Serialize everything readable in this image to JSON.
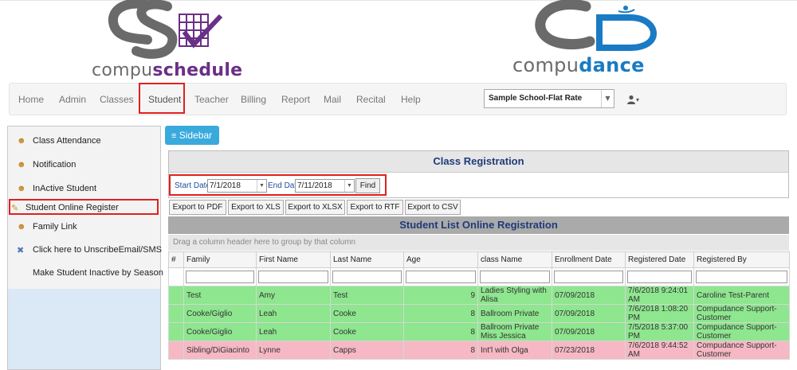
{
  "logos": {
    "left": {
      "prefix": "compu",
      "bold": "schedule"
    },
    "right": {
      "prefix": "compu",
      "bold": "dance"
    }
  },
  "nav": {
    "items": [
      "Home",
      "Admin",
      "Classes",
      "Student",
      "Teacher",
      "Billing",
      "Report",
      "Mail",
      "Recital",
      "Help"
    ],
    "active": "Student",
    "school_select": "Sample School-Flat Rate",
    "user_icon": "user-icon"
  },
  "sidebar": {
    "toggle_label": "Sidebar",
    "items": [
      {
        "label": "Class Attendance",
        "icon": "users-icon"
      },
      {
        "label": "Notification",
        "icon": "users-icon"
      },
      {
        "label": "InActive Student",
        "icon": "users-icon"
      },
      {
        "label": "Student Online Register",
        "icon": "pencil-icon"
      },
      {
        "label": "Family Link",
        "icon": "users-icon"
      },
      {
        "label": "Click here to UnscribeEmail/SMS",
        "icon": "wrench-icon"
      },
      {
        "label": "Make Student Inactive by Season",
        "icon": ""
      }
    ]
  },
  "registration": {
    "title": "Class Registration",
    "start_label": "Start Date",
    "start_value": "7/1/2018",
    "end_label": "End Date",
    "end_value": "7/11/2018",
    "find_label": "Find"
  },
  "exports": [
    "Export to PDF",
    "Export to XLS",
    "Export to XLSX",
    "Export to RTF",
    "Export to CSV"
  ],
  "student_list": {
    "title": "Student List Online Registration",
    "group_hint": "Drag a column header here to group by that column",
    "columns": [
      "#",
      "Family",
      "First Name",
      "Last Name",
      "Age",
      "class Name",
      "Enrollment Date",
      "Registered Date",
      "Registered By"
    ],
    "rows": [
      {
        "family": "Test",
        "first": "Amy",
        "last": "Test",
        "age": "9",
        "class": "Ladies Styling with Alisa",
        "enroll": "07/09/2018",
        "registered": "7/6/2018 9:24:01 AM",
        "by": "Caroline Test-Parent",
        "status": "green"
      },
      {
        "family": "Cooke/Giglio",
        "first": "Leah",
        "last": "Cooke",
        "age": "8",
        "class": "Ballroom Private",
        "enroll": "07/09/2018",
        "registered": "7/6/2018 1:08:20 PM",
        "by": "Compudance Support-Customer",
        "status": "green"
      },
      {
        "family": "Cooke/Giglio",
        "first": "Leah",
        "last": "Cooke",
        "age": "8",
        "class": "Ballroom Private Miss Jessica",
        "enroll": "07/09/2018",
        "registered": "7/5/2018 5:37:00 PM",
        "by": "Compudance Support-Customer",
        "status": "green"
      },
      {
        "family": "Sibling/DiGiacinto",
        "first": "Lynne",
        "last": "Capps",
        "age": "8",
        "class": "Int'l with Olga",
        "enroll": "07/23/2018",
        "registered": "7/6/2018 9:44:52 AM",
        "by": "Compudance Support-Customer",
        "status": "pink"
      }
    ]
  },
  "colors": {
    "row_green": "#8ee68f",
    "row_pink": "#f6b8c4",
    "title_blue": "#1f3b78",
    "sidebar_button": "#3aaadd",
    "highlight_red": "#e02020"
  }
}
